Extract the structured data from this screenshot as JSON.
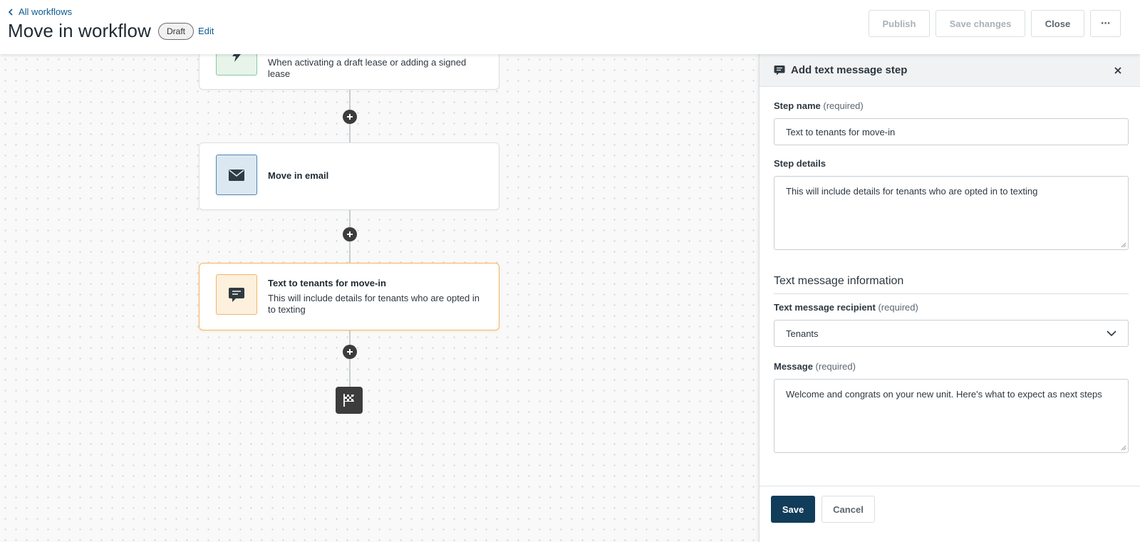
{
  "header": {
    "back_label": "All workflows",
    "title": "Move in workflow",
    "status_badge": "Draft",
    "edit_label": "Edit",
    "buttons": {
      "publish": "Publish",
      "save_changes": "Save changes",
      "close": "Close",
      "more": "⋯"
    }
  },
  "canvas": {
    "steps": [
      {
        "icon": "lightning-icon",
        "title": "",
        "description": "When activating a draft lease or adding a signed lease"
      },
      {
        "icon": "envelope-icon",
        "title": "Move in email",
        "description": ""
      },
      {
        "icon": "chat-message-icon",
        "title": "Text to tenants for move-in",
        "description": "This will include details for tenants who are opted in to texting"
      }
    ],
    "end_icon": "checkered-flag-icon"
  },
  "panel": {
    "title": "Add text message step",
    "step_name": {
      "label": "Step name",
      "required": "(required)",
      "value": "Text to tenants for move-in"
    },
    "step_details": {
      "label": "Step details",
      "value": "This will include details for tenants who are opted in to texting"
    },
    "section_title": "Text message information",
    "recipient": {
      "label": "Text message recipient",
      "required": "(required)",
      "value": "Tenants"
    },
    "message": {
      "label": "Message",
      "required": "(required)",
      "value": "Welcome and congrats on your new unit. Here's what to expect as next steps"
    },
    "save_label": "Save",
    "cancel_label": "Cancel"
  },
  "colors": {
    "link": "#0d5c91",
    "primary_button": "#113c5a",
    "selected_card_border": "#f2b768"
  }
}
